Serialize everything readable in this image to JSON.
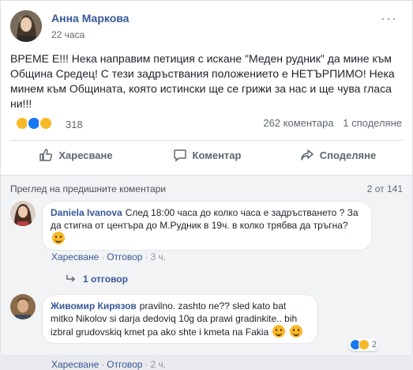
{
  "post": {
    "author": "Анна Маркова",
    "time": "22 часа",
    "more": "···",
    "text": "ВРЕМЕ Е!!! Нека направим петиция с искане \"Меден рудник\" да мине към Община Средец! С тези задръствания положението е НЕТЪРПИМО! Нека минем към Общината, която истински ще се грижи за нас и ще чува гласа ни!!!",
    "reaction_count": "318",
    "comments_count": "262 коментара",
    "shares_count": "1 споделяне"
  },
  "actions": {
    "like": "Харесване",
    "comment": "Коментар",
    "share": "Споделяне"
  },
  "comments_section": {
    "prev_label": "Преглед на предишните коментари",
    "count": "2 от 141",
    "items": [
      {
        "name": "Daniela Ivanova",
        "text": "След 18:00 часа до колко часа е задръстването ? За да стигна от центъра до М.Рудник в 19ч. в колко трябва да тръгна?",
        "like": "Харесване",
        "reply": "Отговор",
        "time": "3 ч.",
        "replies": "1 отговор"
      },
      {
        "name": "Живомир Кирязов",
        "text": "pravilno. zashto ne?? sled kato bat mitko Nikolov si darja dedoviq 10g da prawi gradinkite.. bih izbral grudovskiq kmet pa ako shte i kmeta na Fakia",
        "like": "Харесване",
        "reply": "Отговор",
        "time": "2 ч.",
        "badge_count": "2"
      }
    ]
  },
  "colors": {
    "link": "#385898",
    "like_blue": "#1877f2",
    "haha_yellow": "#f7b928",
    "love_red": "#f33e58"
  }
}
